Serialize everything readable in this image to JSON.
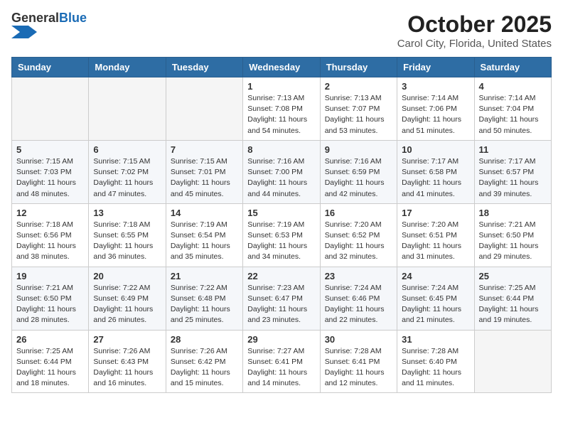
{
  "header": {
    "logo_general": "General",
    "logo_blue": "Blue",
    "main_title": "October 2025",
    "subtitle": "Carol City, Florida, United States"
  },
  "calendar": {
    "days_of_week": [
      "Sunday",
      "Monday",
      "Tuesday",
      "Wednesday",
      "Thursday",
      "Friday",
      "Saturday"
    ],
    "weeks": [
      [
        {
          "day": "",
          "info": ""
        },
        {
          "day": "",
          "info": ""
        },
        {
          "day": "",
          "info": ""
        },
        {
          "day": "1",
          "info": "Sunrise: 7:13 AM\nSunset: 7:08 PM\nDaylight: 11 hours\nand 54 minutes."
        },
        {
          "day": "2",
          "info": "Sunrise: 7:13 AM\nSunset: 7:07 PM\nDaylight: 11 hours\nand 53 minutes."
        },
        {
          "day": "3",
          "info": "Sunrise: 7:14 AM\nSunset: 7:06 PM\nDaylight: 11 hours\nand 51 minutes."
        },
        {
          "day": "4",
          "info": "Sunrise: 7:14 AM\nSunset: 7:04 PM\nDaylight: 11 hours\nand 50 minutes."
        }
      ],
      [
        {
          "day": "5",
          "info": "Sunrise: 7:15 AM\nSunset: 7:03 PM\nDaylight: 11 hours\nand 48 minutes."
        },
        {
          "day": "6",
          "info": "Sunrise: 7:15 AM\nSunset: 7:02 PM\nDaylight: 11 hours\nand 47 minutes."
        },
        {
          "day": "7",
          "info": "Sunrise: 7:15 AM\nSunset: 7:01 PM\nDaylight: 11 hours\nand 45 minutes."
        },
        {
          "day": "8",
          "info": "Sunrise: 7:16 AM\nSunset: 7:00 PM\nDaylight: 11 hours\nand 44 minutes."
        },
        {
          "day": "9",
          "info": "Sunrise: 7:16 AM\nSunset: 6:59 PM\nDaylight: 11 hours\nand 42 minutes."
        },
        {
          "day": "10",
          "info": "Sunrise: 7:17 AM\nSunset: 6:58 PM\nDaylight: 11 hours\nand 41 minutes."
        },
        {
          "day": "11",
          "info": "Sunrise: 7:17 AM\nSunset: 6:57 PM\nDaylight: 11 hours\nand 39 minutes."
        }
      ],
      [
        {
          "day": "12",
          "info": "Sunrise: 7:18 AM\nSunset: 6:56 PM\nDaylight: 11 hours\nand 38 minutes."
        },
        {
          "day": "13",
          "info": "Sunrise: 7:18 AM\nSunset: 6:55 PM\nDaylight: 11 hours\nand 36 minutes."
        },
        {
          "day": "14",
          "info": "Sunrise: 7:19 AM\nSunset: 6:54 PM\nDaylight: 11 hours\nand 35 minutes."
        },
        {
          "day": "15",
          "info": "Sunrise: 7:19 AM\nSunset: 6:53 PM\nDaylight: 11 hours\nand 34 minutes."
        },
        {
          "day": "16",
          "info": "Sunrise: 7:20 AM\nSunset: 6:52 PM\nDaylight: 11 hours\nand 32 minutes."
        },
        {
          "day": "17",
          "info": "Sunrise: 7:20 AM\nSunset: 6:51 PM\nDaylight: 11 hours\nand 31 minutes."
        },
        {
          "day": "18",
          "info": "Sunrise: 7:21 AM\nSunset: 6:50 PM\nDaylight: 11 hours\nand 29 minutes."
        }
      ],
      [
        {
          "day": "19",
          "info": "Sunrise: 7:21 AM\nSunset: 6:50 PM\nDaylight: 11 hours\nand 28 minutes."
        },
        {
          "day": "20",
          "info": "Sunrise: 7:22 AM\nSunset: 6:49 PM\nDaylight: 11 hours\nand 26 minutes."
        },
        {
          "day": "21",
          "info": "Sunrise: 7:22 AM\nSunset: 6:48 PM\nDaylight: 11 hours\nand 25 minutes."
        },
        {
          "day": "22",
          "info": "Sunrise: 7:23 AM\nSunset: 6:47 PM\nDaylight: 11 hours\nand 23 minutes."
        },
        {
          "day": "23",
          "info": "Sunrise: 7:24 AM\nSunset: 6:46 PM\nDaylight: 11 hours\nand 22 minutes."
        },
        {
          "day": "24",
          "info": "Sunrise: 7:24 AM\nSunset: 6:45 PM\nDaylight: 11 hours\nand 21 minutes."
        },
        {
          "day": "25",
          "info": "Sunrise: 7:25 AM\nSunset: 6:44 PM\nDaylight: 11 hours\nand 19 minutes."
        }
      ],
      [
        {
          "day": "26",
          "info": "Sunrise: 7:25 AM\nSunset: 6:44 PM\nDaylight: 11 hours\nand 18 minutes."
        },
        {
          "day": "27",
          "info": "Sunrise: 7:26 AM\nSunset: 6:43 PM\nDaylight: 11 hours\nand 16 minutes."
        },
        {
          "day": "28",
          "info": "Sunrise: 7:26 AM\nSunset: 6:42 PM\nDaylight: 11 hours\nand 15 minutes."
        },
        {
          "day": "29",
          "info": "Sunrise: 7:27 AM\nSunset: 6:41 PM\nDaylight: 11 hours\nand 14 minutes."
        },
        {
          "day": "30",
          "info": "Sunrise: 7:28 AM\nSunset: 6:41 PM\nDaylight: 11 hours\nand 12 minutes."
        },
        {
          "day": "31",
          "info": "Sunrise: 7:28 AM\nSunset: 6:40 PM\nDaylight: 11 hours\nand 11 minutes."
        },
        {
          "day": "",
          "info": ""
        }
      ]
    ]
  }
}
